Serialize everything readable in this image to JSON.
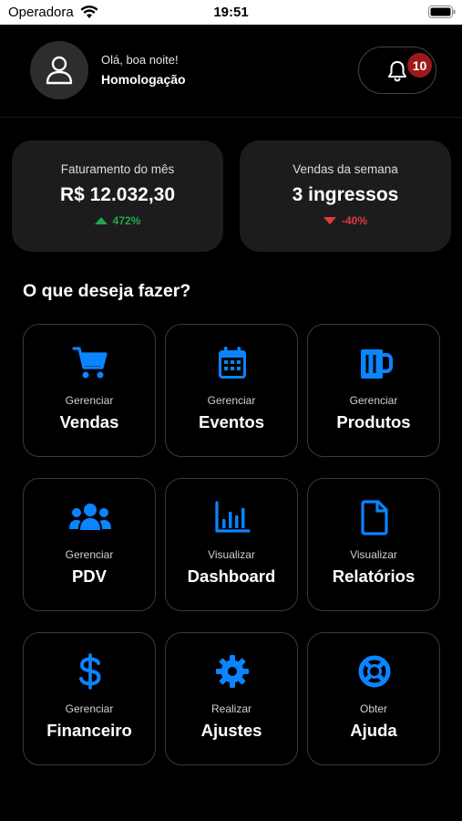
{
  "status_bar": {
    "carrier": "Operadora",
    "time": "19:51"
  },
  "header": {
    "greeting": "Olá, boa noite!",
    "user_name": "Homologação",
    "notification_count": "10"
  },
  "stats": [
    {
      "label": "Faturamento do mês",
      "value": "R$ 12.032,30",
      "change": "472%",
      "trend": "up"
    },
    {
      "label": "Vendas da semana",
      "value": "3 ingressos",
      "change": "-40%",
      "trend": "down"
    }
  ],
  "section_title": "O que deseja fazer?",
  "actions": [
    {
      "sub": "Gerenciar",
      "label": "Vendas",
      "icon": "cart-icon"
    },
    {
      "sub": "Gerenciar",
      "label": "Eventos",
      "icon": "calendar-icon"
    },
    {
      "sub": "Gerenciar",
      "label": "Produtos",
      "icon": "mug-icon"
    },
    {
      "sub": "Gerenciar",
      "label": "PDV",
      "icon": "users-icon"
    },
    {
      "sub": "Visualizar",
      "label": "Dashboard",
      "icon": "bar-chart-icon"
    },
    {
      "sub": "Visualizar",
      "label": "Relatórios",
      "icon": "document-icon"
    },
    {
      "sub": "Gerenciar",
      "label": "Financeiro",
      "icon": "dollar-icon"
    },
    {
      "sub": "Realizar",
      "label": "Ajustes",
      "icon": "gear-icon"
    },
    {
      "sub": "Obter",
      "label": "Ajuda",
      "icon": "lifebuoy-icon"
    }
  ],
  "colors": {
    "accent": "#0a84ff",
    "up": "#21a84b",
    "down": "#e03c3c",
    "badge": "#9b1b1b",
    "card": "#1c1c1e"
  }
}
